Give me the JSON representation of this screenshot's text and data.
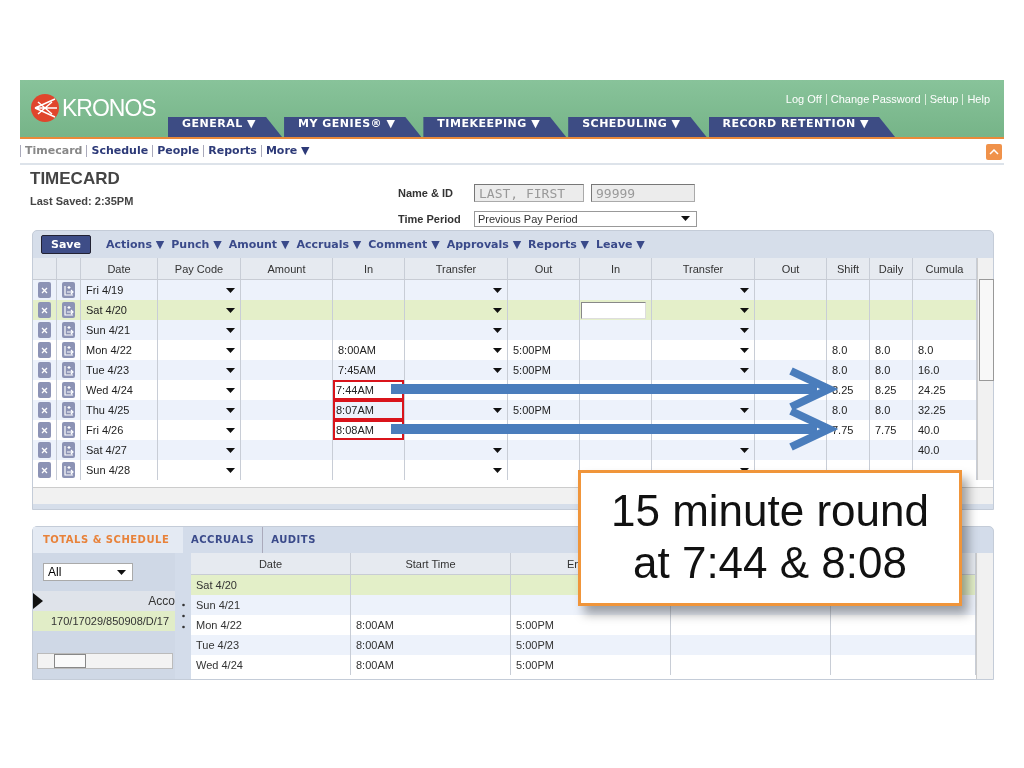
{
  "header": {
    "logo": "KRONOS",
    "links": [
      "Log Off",
      "Change Password",
      "Setup",
      "Help"
    ],
    "tabs": [
      {
        "label": "GENERAL ▼",
        "selected": false
      },
      {
        "label": "MY GENIES® ▼",
        "selected": false
      },
      {
        "label": "TIMEKEEPING ▼",
        "selected": false
      },
      {
        "label": "SCHEDULING ▼",
        "selected": false
      },
      {
        "label": "RECORD RETENTION ▼",
        "selected": false
      }
    ]
  },
  "subnav": [
    {
      "label": "Timecard",
      "selected": true
    },
    {
      "label": "Schedule",
      "selected": false
    },
    {
      "label": "People",
      "selected": false
    },
    {
      "label": "Reports",
      "selected": false
    },
    {
      "label": "More ▼",
      "selected": false
    }
  ],
  "page": {
    "title": "TIMECARD",
    "last_saved": "Last Saved: 2:35PM",
    "name_label": "Name & ID",
    "name_value": "LAST, FIRST",
    "id_value": "99999",
    "period_label": "Time Period",
    "period_value": "Previous Pay Period"
  },
  "toolbar": {
    "save": "Save",
    "menus": [
      "Actions ▼",
      "Punch ▼",
      "Amount ▼",
      "Accruals ▼",
      "Comment ▼",
      "Approvals ▼",
      "Reports ▼",
      "Leave ▼"
    ]
  },
  "timecard": {
    "columns": [
      "Date",
      "Pay Code",
      "Amount",
      "In",
      "Transfer",
      "Out",
      "In",
      "Transfer",
      "Out",
      "Shift",
      "Daily",
      "Cumula"
    ],
    "rows": [
      {
        "date": "Fri 4/19",
        "selected": false,
        "flagged": false,
        "arrow": false
      },
      {
        "date": "Sat 4/20",
        "selected": true,
        "flagged": false,
        "arrow": false,
        "in2_field": true
      },
      {
        "date": "Sun 4/21",
        "selected": false,
        "flagged": false,
        "arrow": false
      },
      {
        "date": "Mon 4/22",
        "in": "8:00AM",
        "out": "5:00PM",
        "shift": "8.0",
        "daily": "8.0",
        "cumulative": "8.0",
        "selected": false,
        "flagged": false,
        "arrow": false
      },
      {
        "date": "Tue 4/23",
        "in": "7:45AM",
        "out": "5:00PM",
        "shift": "8.0",
        "daily": "8.0",
        "cumulative": "16.0",
        "selected": false,
        "flagged": false,
        "arrow": false
      },
      {
        "date": "Wed 4/24",
        "in": "7:44AM",
        "shift": "8.25",
        "daily": "8.25",
        "cumulative": "24.25",
        "selected": false,
        "flagged": true,
        "arrow": true
      },
      {
        "date": "Thu 4/25",
        "in": "8:07AM",
        "out": "5:00PM",
        "shift": "8.0",
        "daily": "8.0",
        "cumulative": "32.25",
        "selected": false,
        "flagged": true,
        "arrow": false
      },
      {
        "date": "Fri 4/26",
        "in": "8:08AM",
        "shift": "7.75",
        "daily": "7.75",
        "cumulative": "40.0",
        "selected": false,
        "flagged": true,
        "arrow": true
      },
      {
        "date": "Sat 4/27",
        "cumulative": "40.0",
        "selected": false,
        "flagged": false,
        "arrow": false
      },
      {
        "date": "Sun 4/28",
        "selected": false,
        "flagged": false,
        "arrow": false
      }
    ]
  },
  "totals": {
    "tabs": [
      {
        "label": "TOTALS & SCHEDULE",
        "selected": true
      },
      {
        "label": "ACCRUALS",
        "selected": false
      },
      {
        "label": "AUDITS",
        "selected": false
      }
    ],
    "filter": "All",
    "account_column": "Acco",
    "accounts": [
      {
        "label": "170/17029/850908/D/17",
        "selected": true
      }
    ],
    "columns": [
      "Date",
      "Start Time",
      "En"
    ],
    "rows": [
      {
        "date": "Sat 4/20",
        "selected": true
      },
      {
        "date": "Sun 4/21",
        "selected": false
      },
      {
        "date": "Mon 4/22",
        "start": "8:00AM",
        "end": "5:00PM",
        "selected": false
      },
      {
        "date": "Tue 4/23",
        "start": "8:00AM",
        "end": "5:00PM",
        "selected": false
      },
      {
        "date": "Wed 4/24",
        "start": "8:00AM",
        "end": "5:00PM",
        "selected": false
      }
    ]
  },
  "callout": "15 minute round\nat 7:44 & 8:08"
}
